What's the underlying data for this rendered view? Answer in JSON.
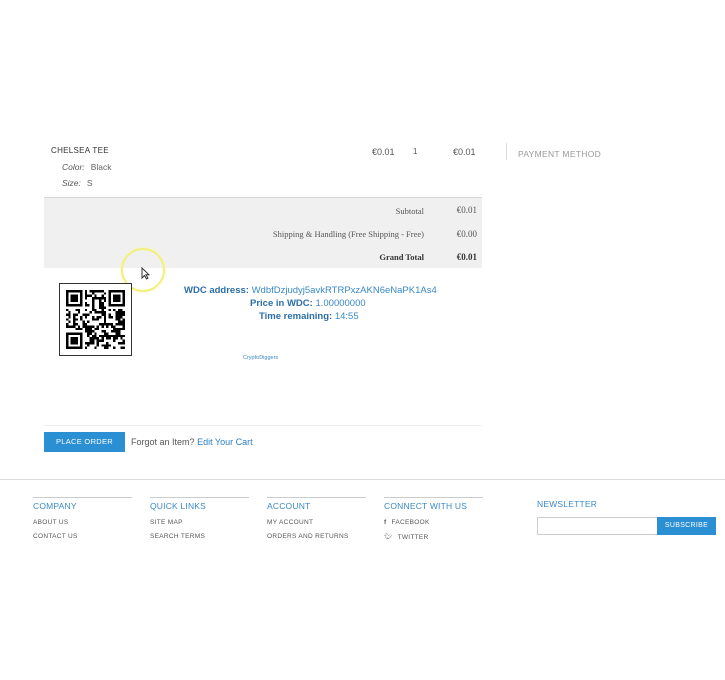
{
  "order_item": {
    "name": "CHELSEA TEE",
    "options": [
      {
        "label": "Color:",
        "value": "Black"
      },
      {
        "label": "Size:",
        "value": "S"
      }
    ],
    "price": "€0.01",
    "qty": "1",
    "subtotal": "€0.01"
  },
  "payment_method": {
    "title": "PAYMENT METHOD"
  },
  "totals": {
    "subtotal_label": "Subtotal",
    "subtotal_value": "€0.01",
    "shipping_label": "Shipping & Handling (Free Shipping - Free)",
    "shipping_value": "€0.00",
    "grand_label": "Grand Total",
    "grand_value": "€0.01"
  },
  "wdc": {
    "address_label": "WDC address:",
    "address_value": "WdbfDzjudyj5avkRTRPxzAKN6eNaPK1As4",
    "price_label": "Price in WDC:",
    "price_value": "1.00000000",
    "time_label": "Time remaining:",
    "time_value": "14:55",
    "powered_by": "CryptoDiggers"
  },
  "actions": {
    "place_order": "PLACE ORDER",
    "forgot_text": "Forgot an Item?",
    "edit_cart": "Edit Your Cart"
  },
  "footer": {
    "company": {
      "title": "COMPANY",
      "links": [
        "ABOUT US",
        "CONTACT US"
      ]
    },
    "quick_links": {
      "title": "QUICK LINKS",
      "links": [
        "SITE MAP",
        "SEARCH TERMS"
      ]
    },
    "account": {
      "title": "ACCOUNT",
      "links": [
        "MY ACCOUNT",
        "ORDERS AND RETURNS"
      ]
    },
    "connect": {
      "title": "CONNECT WITH US",
      "links": [
        "FACEBOOK",
        "TWITTER"
      ]
    },
    "newsletter": {
      "title": "NEWSLETTER",
      "button": "SUBSCRIBE",
      "placeholder": ""
    }
  },
  "colors": {
    "accent": "#2a8fd3",
    "link": "#3a8ac6",
    "cursor_highlight": "#f2f07a"
  },
  "icons": [
    "qr-code",
    "cursor-arrow",
    "facebook-icon",
    "twitter-icon"
  ]
}
